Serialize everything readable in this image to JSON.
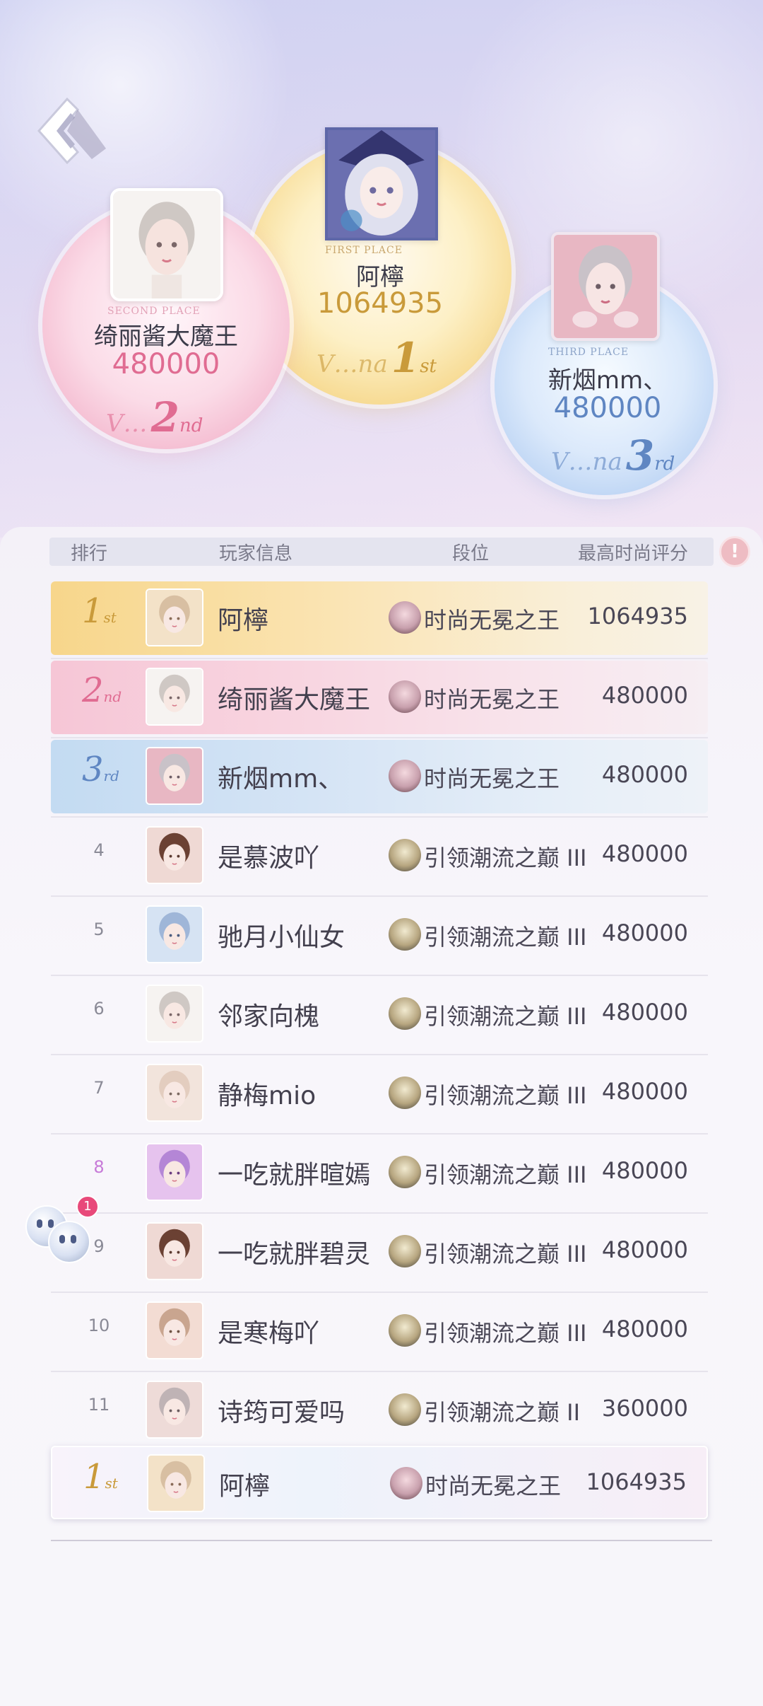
{
  "podium": {
    "first": {
      "place": "FIRST PLACE",
      "name": "阿檸",
      "score": "1064935",
      "rank_num": "1",
      "rank_suffix": "st",
      "script": "V…na"
    },
    "second": {
      "place": "SECOND PLACE",
      "name": "绮丽酱大魔王",
      "score": "480000",
      "rank_num": "2",
      "rank_suffix": "nd",
      "script": "V…"
    },
    "third": {
      "place": "THIRD PLACE",
      "name": "新烟mm、",
      "score": "480000",
      "rank_num": "3",
      "rank_suffix": "rd",
      "script": "V…na"
    }
  },
  "table": {
    "headers": [
      "排行",
      "玩家信息",
      "段位",
      "最高时尚评分"
    ],
    "info_icon": "info-icon",
    "rows": [
      {
        "rank": "1",
        "suffix": "st",
        "name": "阿檸",
        "tier": "时尚无冕之王",
        "score": "1064935"
      },
      {
        "rank": "2",
        "suffix": "nd",
        "name": "绮丽酱大魔王",
        "tier": "时尚无冕之王",
        "score": "480000"
      },
      {
        "rank": "3",
        "suffix": "rd",
        "name": "新烟mm、",
        "tier": "时尚无冕之王",
        "score": "480000"
      },
      {
        "rank": "4",
        "name": "是慕波吖",
        "tier": "引领潮流之巅 III",
        "score": "480000"
      },
      {
        "rank": "5",
        "name": "驰月小仙女",
        "tier": "引领潮流之巅 III",
        "score": "480000"
      },
      {
        "rank": "6",
        "name": "邻家向槐",
        "tier": "引领潮流之巅 III",
        "score": "480000"
      },
      {
        "rank": "7",
        "name": "静梅mio",
        "tier": "引领潮流之巅 III",
        "score": "480000"
      },
      {
        "rank": "8",
        "name": "一吃就胖暄嫣",
        "tier": "引领潮流之巅 III",
        "score": "480000"
      },
      {
        "rank": "9",
        "name": "一吃就胖碧灵",
        "tier": "引领潮流之巅 III",
        "score": "480000"
      },
      {
        "rank": "10",
        "name": "是寒梅吖",
        "tier": "引领潮流之巅 III",
        "score": "480000"
      },
      {
        "rank": "11",
        "name": "诗筠可爱吗",
        "tier": "引领潮流之巅 II",
        "score": "360000"
      }
    ],
    "me": {
      "rank": "1",
      "suffix": "st",
      "name": "阿檸",
      "tier": "时尚无冕之王",
      "score": "1064935"
    }
  },
  "float_button": {
    "badge": "1"
  },
  "colors": {
    "gold": "#c99a3a",
    "pink": "#e06c92",
    "blue": "#5f86c2",
    "text": "#43404e"
  }
}
